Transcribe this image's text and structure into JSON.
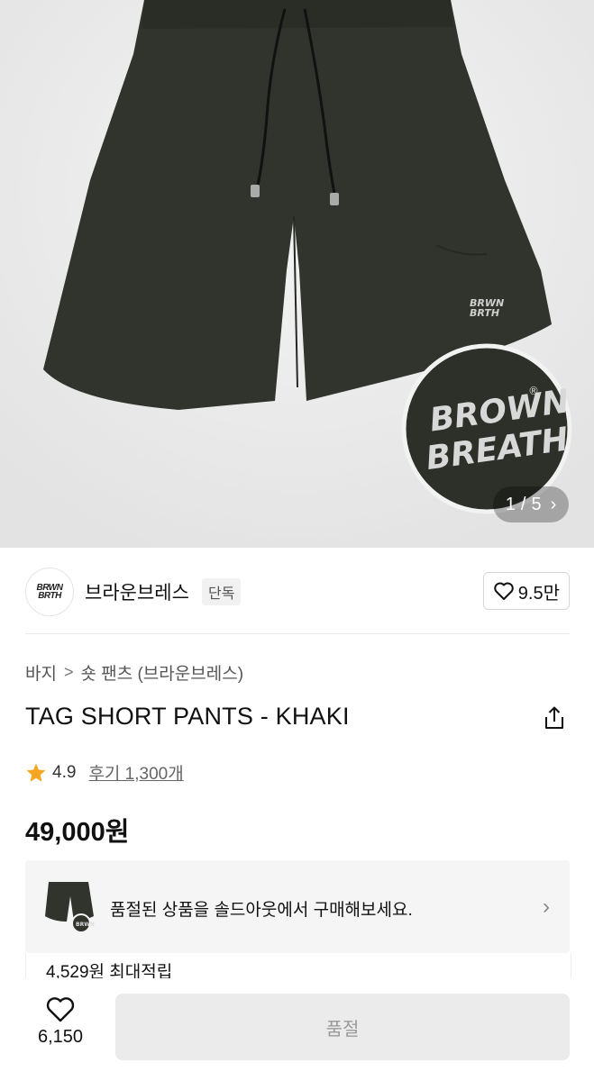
{
  "gallery": {
    "counter_current": "1",
    "counter_separator": "/",
    "counter_total": "5",
    "logo_text": "BROWN BREATH"
  },
  "brand": {
    "name": "브라운브레스",
    "badge": "단독",
    "likes": "9.5만"
  },
  "breadcrumb": {
    "items": [
      "바지",
      "숏 팬츠 (브라운브레스)"
    ],
    "separator": ">"
  },
  "product": {
    "title": "TAG SHORT PANTS - KHAKI",
    "rating": "4.9",
    "reviews": "후기 1,300개",
    "price": "49,000원"
  },
  "soldout": {
    "text": "품절된 상품을 솔드아웃에서 구매해보세요."
  },
  "points": {
    "text": "4,529원 최대적립"
  },
  "bottom_bar": {
    "wish_count": "6,150",
    "buy_label": "품절"
  },
  "colors": {
    "star": "#f5a623",
    "pants": "#2f322b",
    "buy_disabled_bg": "#ebebeb"
  },
  "icons": [
    "chevron-right-icon",
    "heart-icon",
    "share-icon",
    "star-icon"
  ]
}
